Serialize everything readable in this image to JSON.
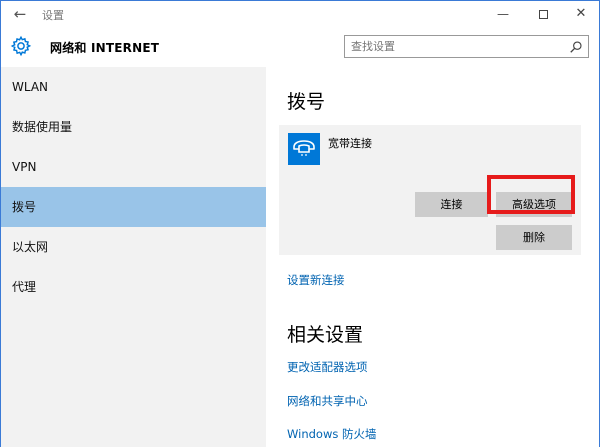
{
  "titlebar": {
    "back_glyph": "←",
    "title": "设置",
    "minimize_glyph": "—",
    "close_glyph": "✕"
  },
  "header": {
    "app_title": "网络和 INTERNET",
    "search_placeholder": "查找设置",
    "icons": [
      "gear-icon",
      "search-icon"
    ]
  },
  "sidebar": {
    "items": [
      {
        "label": "WLAN"
      },
      {
        "label": "数据使用量"
      },
      {
        "label": "VPN"
      },
      {
        "label": "拨号",
        "selected": true
      },
      {
        "label": "以太网"
      },
      {
        "label": "代理"
      }
    ]
  },
  "main": {
    "title": "拨号",
    "connection": {
      "name": "宽带连接",
      "icon": "phone-icon",
      "connect_label": "连接",
      "advanced_label": "高级选项",
      "delete_label": "删除"
    },
    "new_connection_link": "设置新连接",
    "related_title": "相关设置",
    "related_links": [
      "更改适配器选项",
      "网络和共享中心",
      "Windows 防火墙"
    ]
  },
  "colors": {
    "accent": "#0078d7",
    "selected_nav": "#99c4e8",
    "link": "#0063b1",
    "highlight": "#e61b1b"
  }
}
